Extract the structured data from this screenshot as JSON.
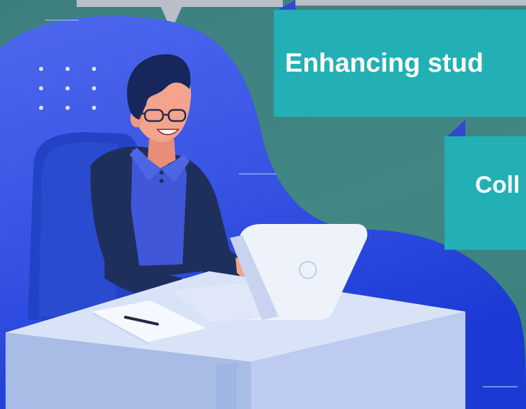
{
  "callouts": [
    {
      "text": "Enhancing stud"
    },
    {
      "text": "Coll"
    }
  ],
  "colors": {
    "background": "#3f8482",
    "blob_top": "#4b63ea",
    "blob_bottom": "#1d3ed8",
    "callout": "#22b0b5",
    "desk_top": "#d9e3f7",
    "desk_front": "#a9bde6",
    "laptop": "#eef2fb",
    "jacket": "#1f2f5c",
    "shirt": "#3f57d8",
    "skin": "#f4a38d",
    "hair": "#17265b"
  },
  "icons": {
    "dot_grid": "dot-grid-icon",
    "laptop_logo": "laptop-logo-icon",
    "pen": "pen-icon"
  }
}
